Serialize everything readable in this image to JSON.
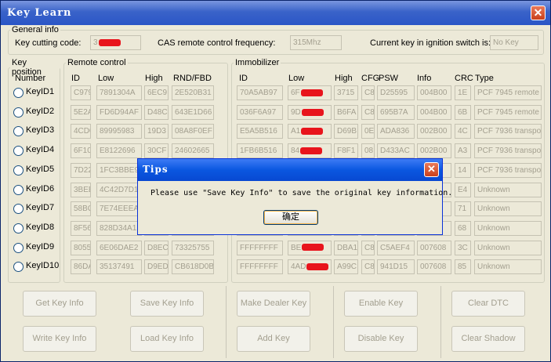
{
  "window": {
    "title": "Key Learn",
    "close": "✕"
  },
  "general": {
    "legend": "General info",
    "cutting_label": "Key cutting code:",
    "cutting_value": "3",
    "cas_label": "CAS remote control frequency:",
    "cas_value": "315Mhz",
    "current_label": "Current key in ignition switch is:",
    "current_value": "No Key"
  },
  "key_position": {
    "legend": "Key position",
    "number_label": "Number",
    "keys": [
      "KeyID1",
      "KeyID2",
      "KeyID3",
      "KeyID4",
      "KeyID5",
      "KeyID6",
      "KeyID7",
      "KeyID8",
      "KeyID9",
      "KeyID10"
    ]
  },
  "remote": {
    "legend": "Remote control",
    "headers": [
      "ID",
      "Low",
      "High",
      "RND/FBD"
    ],
    "rows": [
      [
        "C979",
        "7891304A",
        "6EC9",
        "2E520B31"
      ],
      [
        "5E2A",
        "FD6D94AF",
        "D48C",
        "643E1D66"
      ],
      [
        "4CD0",
        "89995983",
        "19D3",
        "08A8F0EF"
      ],
      [
        "6F10",
        "E8122696",
        "30CF",
        "24602665"
      ],
      [
        "7D22",
        "1FC3BBE9",
        "",
        ""
      ],
      [
        "3BEE",
        "4C42D7D1",
        "",
        ""
      ],
      [
        "58BC",
        "7E74EEEA",
        "",
        ""
      ],
      [
        "8F56",
        "828D34A1",
        "",
        ""
      ],
      [
        "8055",
        "6E06DAE2",
        "D8EC",
        "73325755"
      ],
      [
        "86DA",
        "35137491",
        "D9ED",
        "CB618D0B"
      ]
    ]
  },
  "immobilizer": {
    "legend": "Immobilizer",
    "headers": [
      "ID",
      "Low",
      "High",
      "CFG",
      "PSW",
      "Info",
      "CRC",
      "Type"
    ],
    "rows": [
      [
        "70A5AB97",
        "6F",
        "3715",
        "C8",
        "D25595",
        "004B00",
        "1E",
        "PCF 7945 remote"
      ],
      [
        "036F6A97",
        "9D",
        "B6FA",
        "C8",
        "695B7A",
        "004B00",
        "6B",
        "PCF 7945 remote"
      ],
      [
        "E5A5B516",
        "A1",
        "D69B",
        "0E",
        "ADA836",
        "002B00",
        "4C",
        "PCF 7936 transpo"
      ],
      [
        "1FB6B516",
        "84",
        "F8F1",
        "08",
        "D433AC",
        "002B00",
        "A3",
        "PCF 7936 transpo"
      ],
      [
        "",
        "",
        "",
        "",
        "",
        "",
        "14",
        "PCF 7936 transpo"
      ],
      [
        "",
        "",
        "",
        "",
        "",
        "",
        "E4",
        "Unknown"
      ],
      [
        "",
        "",
        "",
        "",
        "",
        "",
        "71",
        "Unknown"
      ],
      [
        "",
        "",
        "",
        "",
        "",
        "",
        "68",
        "Unknown"
      ],
      [
        "FFFFFFFF",
        "BE",
        "DBA1",
        "C8",
        "C5AEF4",
        "007608",
        "3C",
        "Unknown"
      ],
      [
        "FFFFFFFF",
        "4AD",
        "A99C",
        "C8",
        "941D15",
        "007608",
        "85",
        "Unknown"
      ]
    ]
  },
  "buttons": {
    "get_key_info": "Get Key Info",
    "save_key_info": "Save Key Info",
    "make_dealer_key": "Make Dealer Key",
    "enable_key": "Enable Key",
    "clear_dtc": "Clear DTC",
    "write_key_info": "Write Key Info",
    "load_key_info": "Load Key Info",
    "add_key": "Add Key",
    "disable_key": "Disable Key",
    "clear_shadow": "Clear Shadow"
  },
  "dialog": {
    "title": "Tips",
    "close": "✕",
    "message": "Please use \"Save Key Info\" to save the original key information.",
    "ok": "确定"
  },
  "colors": {
    "titlebar": "#2a55c6",
    "redaction": "#e8141c",
    "dialog_titlebar": "#0a57e0"
  }
}
